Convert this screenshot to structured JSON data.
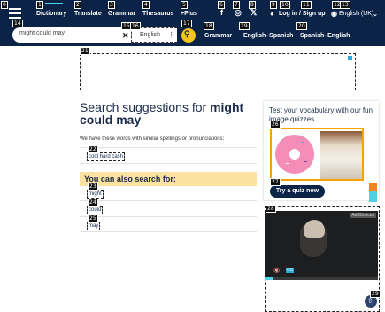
{
  "nav": {
    "items": [
      {
        "label": "Dictionary"
      },
      {
        "label": "Translate"
      },
      {
        "label": "Grammar"
      },
      {
        "label": "Thesaurus"
      },
      {
        "label": "+Plus"
      }
    ],
    "social": {
      "facebook": "f",
      "instagram": "◎",
      "x": "𝕏"
    },
    "login_label": "Log in / Sign up",
    "language_label": "English (UK)"
  },
  "tags": [
    "0",
    "1",
    "2",
    "3",
    "4",
    "5",
    "6",
    "7",
    "8",
    "9",
    "10",
    "11",
    "12",
    "13",
    "14",
    "15",
    "16",
    "17",
    "18",
    "19",
    "20",
    "21",
    "22",
    "23",
    "24",
    "25",
    "26",
    "27",
    "28",
    "29"
  ],
  "search": {
    "value": "might could may",
    "clear_glyph": "✕",
    "language_value": "English",
    "sublinks": [
      {
        "label": "Grammar"
      },
      {
        "label": "English–Spanish"
      },
      {
        "label": "Spanish–English"
      }
    ]
  },
  "main": {
    "title_prefix": "Search suggestions for ",
    "title_bold": "might could may",
    "have_these": "We have these words with similar spellings or pronunciations:",
    "suggestion": "cold hard cash",
    "also_heading": "You can also search for:",
    "also_items": [
      {
        "label": "might"
      },
      {
        "label": "could"
      },
      {
        "label": "may"
      }
    ]
  },
  "quiz": {
    "heading": "Test your vocabulary with our fun image quizzes",
    "button_label": "Try a quiz now"
  },
  "video": {
    "ad_choices": "Ad Choices",
    "progress": 0.08
  },
  "colors": {
    "nav_bg": "#0b2347",
    "accent_yellow": "#f5c518",
    "accent_cyan": "#4fd1e5",
    "band": "#fbe2a0"
  }
}
